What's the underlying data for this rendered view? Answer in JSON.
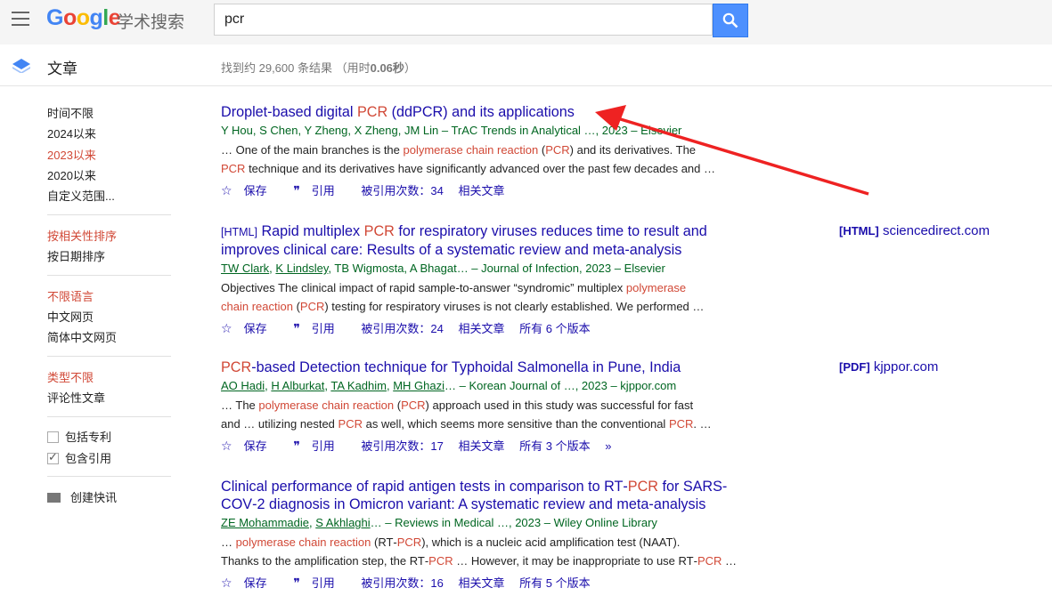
{
  "header": {
    "logo_sub": "学术搜索",
    "search_value": "pcr"
  },
  "subbar": {
    "section_label": "文章",
    "stats_prefix": "找到约 29,600 条结果 （用时",
    "stats_time": "0.06秒",
    "stats_suffix": "）"
  },
  "sidebar": {
    "time_filters": [
      "时间不限",
      "2024以来",
      "2023以来",
      "2020以来",
      "自定义范围..."
    ],
    "time_active_index": 2,
    "sort": [
      "按相关性排序",
      "按日期排序"
    ],
    "language": [
      "不限语言",
      "中文网页",
      "简体中文网页"
    ],
    "type": [
      "类型不限",
      "评论性文章"
    ],
    "include_patents": "包括专利",
    "include_citations": "包含引用",
    "create_alert": "创建快讯"
  },
  "results": [
    {
      "title_parts": [
        "Droplet‐based digital ",
        "PCR",
        " (ddPCR) and its applications"
      ],
      "authors": "Y Hou, S Chen, Y Zheng, X Zheng, JM Lin – TrAC Trends in Analytical …, 2023 – Elsevier",
      "snippet_l1": [
        "… One of the main branches is the ",
        "polymerase chain reaction",
        " (",
        "PCR",
        ") and its derivatives. The"
      ],
      "snippet_l2": [
        "PCR",
        " technique and its derivatives have significantly advanced over the past few decades and …"
      ],
      "actions": {
        "save": "保存",
        "cite": "引用",
        "cited_by": "被引用次数：34",
        "related": "相关文章"
      }
    },
    {
      "tag": "[HTML]",
      "title_l1": [
        "Rapid multiplex ",
        "PCR",
        " for respiratory viruses reduces time to result and"
      ],
      "title_l2": "improves clinical care: Results of a systematic review and meta‐analysis",
      "authors_linked": [
        "TW Clark",
        "K Lindsley"
      ],
      "authors_rest": ", TB Wigmosta, A Bhagat… – Journal of Infection, 2023 – Elsevier",
      "snippet_l1": [
        "Objectives The clinical impact of rapid sample‐to‐answer “syndromic” multiplex ",
        "polymerase"
      ],
      "snippet_l2": [
        "chain reaction",
        " (",
        "PCR",
        ") testing for respiratory viruses is not clearly established. We performed …"
      ],
      "actions": {
        "save": "保存",
        "cite": "引用",
        "cited_by": "被引用次数：24",
        "related": "相关文章",
        "versions": "所有 6 个版本"
      },
      "side_tag": "[HTML]",
      "side_domain": "sciencedirect.com"
    },
    {
      "title_parts": [
        "PCR",
        "‐based Detection technique for Typhoidal Salmonella in Pune, India"
      ],
      "authors_linked": [
        "AO Hadi",
        "H Alburkat",
        "TA Kadhim",
        "MH Ghazi"
      ],
      "authors_rest": "… – Korean Journal of …, 2023 – kjppor.com",
      "snippet_l1": [
        "… The ",
        "polymerase chain reaction",
        " (",
        "PCR",
        ") approach used in this study was successful for fast"
      ],
      "snippet_l2": [
        "and … utilizing nested ",
        "PCR",
        " as well, which seems more sensitive than the conventional ",
        "PCR",
        ". …"
      ],
      "actions": {
        "save": "保存",
        "cite": "引用",
        "cited_by": "被引用次数：17",
        "related": "相关文章",
        "versions": "所有 3 个版本"
      },
      "side_tag": "[PDF]",
      "side_domain": "kjppor.com"
    },
    {
      "title_l1": [
        "Clinical performance of rapid antigen tests in comparison to RT‐",
        "PCR",
        " for SARS‐"
      ],
      "title_l2": "COV‐2 diagnosis in Omicron variant: A systematic review and meta‐analysis",
      "authors_linked": [
        "ZE Mohammadie",
        "S Akhlaghi"
      ],
      "authors_rest": "… – Reviews in Medical …, 2023 – Wiley Online Library",
      "snippet_l1": [
        "… ",
        "polymerase chain reaction",
        " (RT‐",
        "PCR",
        "), which is a nucleic acid amplification test (NAAT)."
      ],
      "snippet_l2": [
        "Thanks to the amplification step, the RT‐",
        "PCR",
        " … However, it may be inappropriate to use RT‐",
        "PCR",
        " …"
      ],
      "actions": {
        "save": "保存",
        "cite": "引用",
        "cited_by": "被引用次数：16",
        "related": "相关文章",
        "versions": "所有 5 个版本"
      }
    }
  ]
}
